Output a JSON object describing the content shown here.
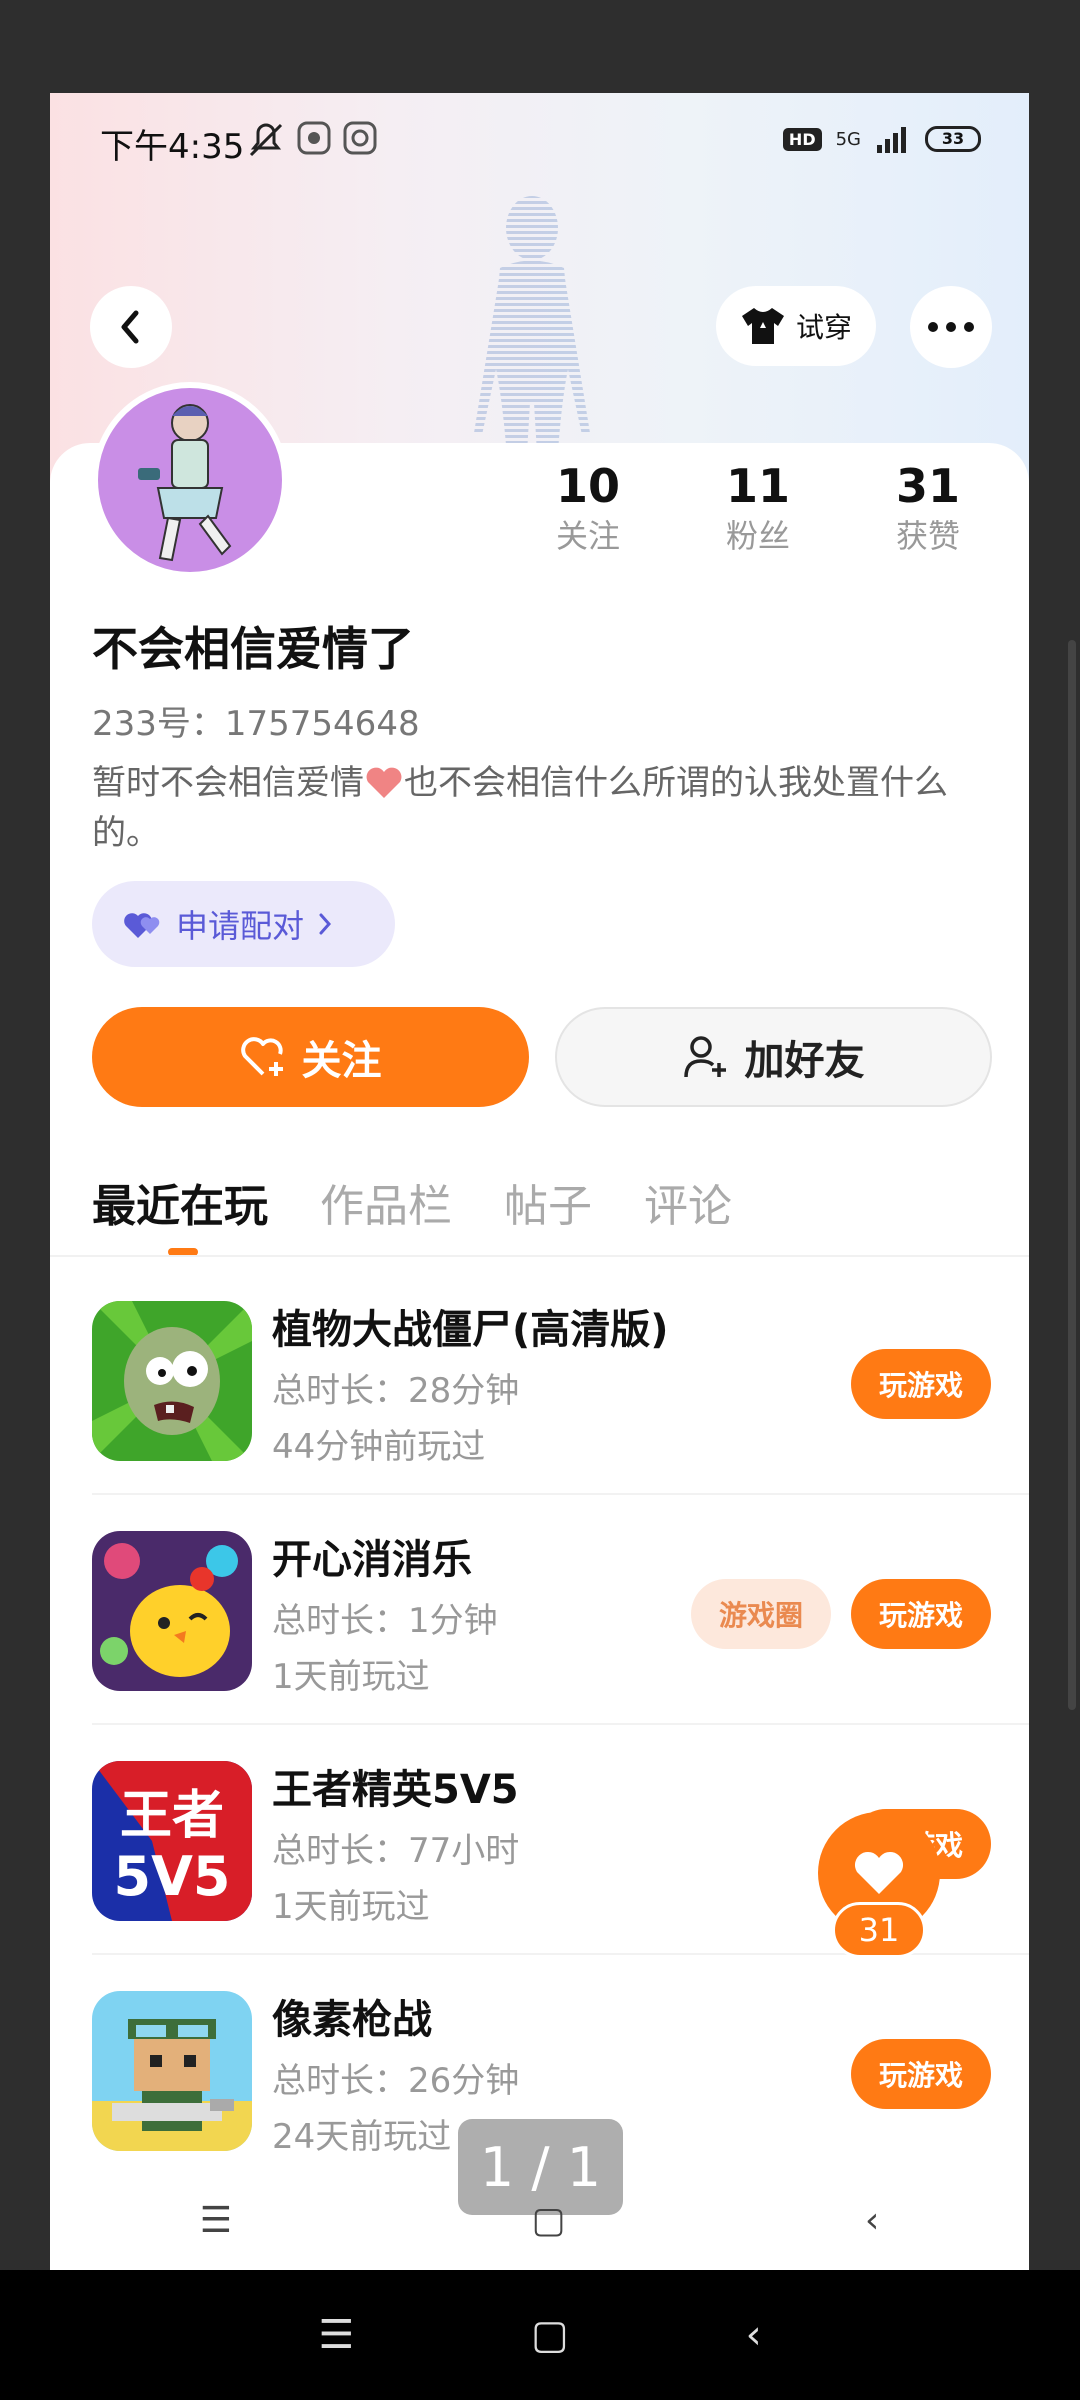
{
  "status": {
    "time": "下午4:35",
    "network": "5G",
    "hd": "HD",
    "battery": "33"
  },
  "header": {
    "try_on_label": "试穿"
  },
  "profile": {
    "stats": [
      {
        "value": "10",
        "label": "关注"
      },
      {
        "value": "11",
        "label": "粉丝"
      },
      {
        "value": "31",
        "label": "获赞"
      }
    ],
    "name": "不会相信爱情了",
    "uid": "233号：175754648",
    "bio_part1": "暂时不会相信爱情",
    "bio_part2": "也不会相信什么所谓的认我处置什么的。",
    "pair_label": "申请配对"
  },
  "actions": {
    "follow_label": "关注",
    "add_friend_label": "加好友"
  },
  "tabs": [
    "最近在玩",
    "作品栏",
    "帖子",
    "评论"
  ],
  "games": [
    {
      "title": "植物大战僵尸(高清版)",
      "duration": "总时长：28分钟",
      "last_played": "44分钟前玩过",
      "play_label": "玩游戏"
    },
    {
      "title": "开心消消乐",
      "duration": "总时长：1分钟",
      "last_played": "1天前玩过",
      "circle_label": "游戏圈",
      "play_label": "玩游戏"
    },
    {
      "title": "王者精英5V5",
      "duration": "总时长：77小时",
      "last_played": "1天前玩过",
      "play_label": "玩游戏",
      "icon_text_1": "王者",
      "icon_text_2": "5V5"
    },
    {
      "title": "像素枪战",
      "duration": "总时长：26分钟",
      "last_played": "24天前玩过",
      "play_label": "玩游戏"
    }
  ],
  "like_fab": {
    "count": "31"
  },
  "page_indicator": "1 / 1",
  "colors": {
    "accent": "#ff7a14",
    "pair": "#5a5ad7"
  }
}
